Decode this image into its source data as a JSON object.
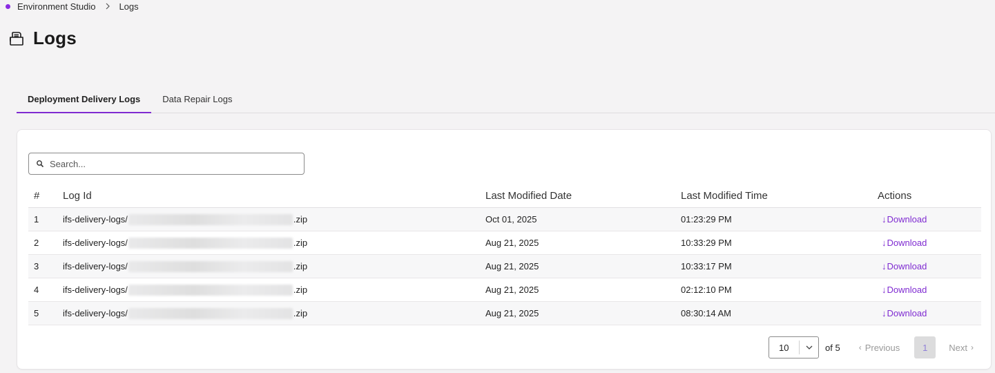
{
  "colors": {
    "accent": "#7f2bd1",
    "crumb_dot": "#8a2be2"
  },
  "breadcrumb": {
    "items": [
      "Environment Studio",
      "Logs"
    ]
  },
  "page": {
    "title": "Logs",
    "icon": "logs-icon"
  },
  "tabs": [
    {
      "label": "Deployment Delivery Logs",
      "active": true
    },
    {
      "label": "Data Repair Logs",
      "active": false
    }
  ],
  "search": {
    "placeholder": "Search...",
    "value": ""
  },
  "table": {
    "headers": {
      "num": "#",
      "log_id": "Log Id",
      "date": "Last Modified Date",
      "time": "Last Modified Time",
      "actions": "Actions"
    },
    "rows": [
      {
        "num": "1",
        "prefix": "ifs-delivery-logs/",
        "suffix": ".zip",
        "date": "Oct 01, 2025",
        "time": "01:23:29 PM",
        "action": "Download"
      },
      {
        "num": "2",
        "prefix": "ifs-delivery-logs/",
        "suffix": ".zip",
        "date": "Aug 21, 2025",
        "time": "10:33:29 PM",
        "action": "Download"
      },
      {
        "num": "3",
        "prefix": "ifs-delivery-logs/",
        "suffix": ".zip",
        "date": "Aug 21, 2025",
        "time": "10:33:17 PM",
        "action": "Download"
      },
      {
        "num": "4",
        "prefix": "ifs-delivery-logs/",
        "suffix": ".zip",
        "date": "Aug 21, 2025",
        "time": "02:12:10 PM",
        "action": "Download"
      },
      {
        "num": "5",
        "prefix": "ifs-delivery-logs/",
        "suffix": ".zip",
        "date": "Aug 21, 2025",
        "time": "08:30:14 AM",
        "action": "Download"
      }
    ]
  },
  "pagination": {
    "page_size": "10",
    "of_text": "of 5",
    "previous": "Previous",
    "current_page": "1",
    "next": "Next"
  }
}
